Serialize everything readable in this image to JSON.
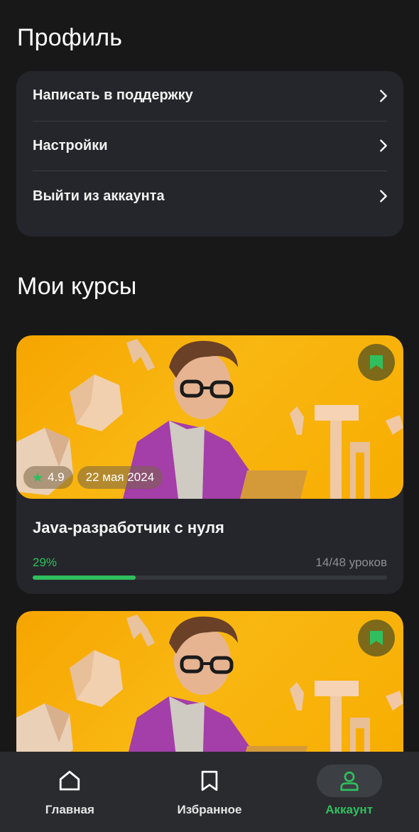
{
  "header": {
    "title": "Профиль"
  },
  "menu": {
    "items": [
      {
        "label": "Написать в поддержку"
      },
      {
        "label": "Настройки"
      },
      {
        "label": "Выйти из аккаунта"
      }
    ]
  },
  "courses_section": {
    "title": "Мои курсы"
  },
  "courses": [
    {
      "rating": "4.9",
      "date": "22 мая 2024",
      "title": "Java-разработчик с нуля",
      "progress_percent_label": "29%",
      "progress": 0.29,
      "lessons_label": "14/48 уроков",
      "bookmarked": true
    },
    {
      "rating": "",
      "date": "",
      "title": "",
      "bookmarked": true
    }
  ],
  "bottom_nav": {
    "items": [
      {
        "label": "Главная",
        "icon": "home-icon",
        "active": false
      },
      {
        "label": "Избранное",
        "icon": "bookmark-icon",
        "active": false
      },
      {
        "label": "Аккаунт",
        "icon": "user-icon",
        "active": true
      }
    ]
  },
  "colors": {
    "background": "#181818",
    "card": "#25262b",
    "accent": "#2fbf5e",
    "image_bg": "#f7ad00"
  }
}
